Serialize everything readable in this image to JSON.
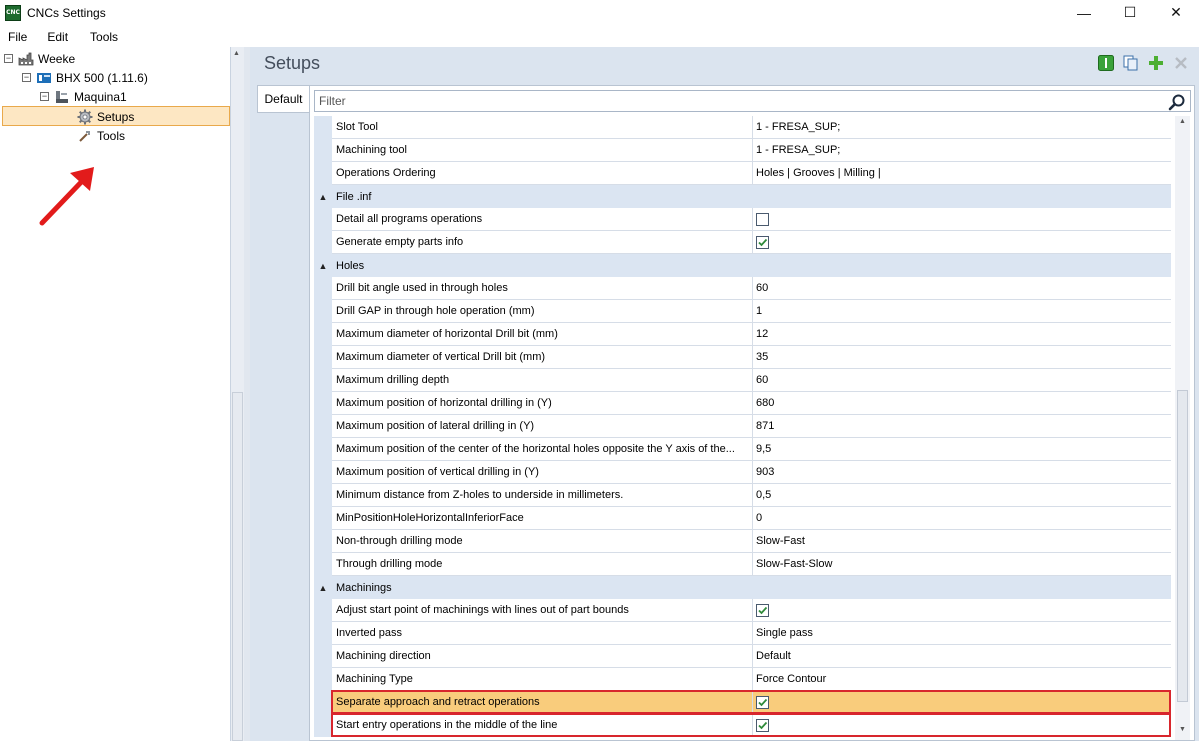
{
  "window": {
    "icon_text": "CNC",
    "title": "CNCs Settings",
    "controls": {
      "minimize": "—",
      "maximize": "☐",
      "close": "✕"
    }
  },
  "menu": [
    "File",
    "Edit",
    "Tools"
  ],
  "tree": {
    "items": [
      {
        "label": "Weeke",
        "toggle": "−",
        "icon": "factory-icon"
      },
      {
        "label": "BHX 500 (1.11.6)",
        "toggle": "−",
        "icon": "cnc-machine-icon"
      },
      {
        "label": "Maquina1",
        "toggle": "−",
        "icon": "machine-icon"
      },
      {
        "label": "Setups",
        "icon": "gear-icon",
        "selected": true
      },
      {
        "label": "Tools",
        "icon": "tools-icon"
      }
    ]
  },
  "panel": {
    "title": "Setups",
    "tab": "Default",
    "filter_placeholder": "Filter",
    "toolbar": [
      "info-icon",
      "copy-icon",
      "add-icon",
      "delete-icon"
    ]
  },
  "grid": {
    "rows": [
      {
        "kind": "prop",
        "name": "Slot Tool",
        "value": "1 - FRESA_SUP;"
      },
      {
        "kind": "prop",
        "name": "Machining tool",
        "value": "1 - FRESA_SUP;"
      },
      {
        "kind": "prop",
        "name": "Operations Ordering",
        "value": "Holes | Grooves | Milling |"
      },
      {
        "kind": "cat",
        "name": "File .inf"
      },
      {
        "kind": "prop",
        "name": "Detail all programs operations",
        "check": false
      },
      {
        "kind": "prop",
        "name": "Generate empty parts info",
        "check": true
      },
      {
        "kind": "cat",
        "name": "Holes"
      },
      {
        "kind": "prop",
        "name": "Drill bit angle used in through holes",
        "value": "60"
      },
      {
        "kind": "prop",
        "name": "Drill GAP in through hole operation (mm)",
        "value": "1"
      },
      {
        "kind": "prop",
        "name": "Maximum diameter of horizontal Drill bit (mm)",
        "value": "12"
      },
      {
        "kind": "prop",
        "name": "Maximum diameter of vertical Drill bit (mm)",
        "value": "35"
      },
      {
        "kind": "prop",
        "name": "Maximum drilling depth",
        "value": "60"
      },
      {
        "kind": "prop",
        "name": "Maximum position of horizontal drilling in (Y)",
        "value": "680"
      },
      {
        "kind": "prop",
        "name": "Maximum position of lateral drilling in (Y)",
        "value": "871"
      },
      {
        "kind": "prop",
        "name": "Maximum position of the center of the horizontal holes opposite the Y axis of the...",
        "value": "9,5"
      },
      {
        "kind": "prop",
        "name": "Maximum position of vertical drilling in (Y)",
        "value": "903"
      },
      {
        "kind": "prop",
        "name": "Minimum distance from Z-holes to underside in millimeters.",
        "value": "0,5"
      },
      {
        "kind": "prop",
        "name": "MinPositionHoleHorizontalInferiorFace",
        "value": "0"
      },
      {
        "kind": "prop",
        "name": "Non-through drilling mode",
        "value": "Slow-Fast"
      },
      {
        "kind": "prop",
        "name": "Through drilling mode",
        "value": "Slow-Fast-Slow"
      },
      {
        "kind": "cat",
        "name": "Machinings"
      },
      {
        "kind": "prop",
        "name": "Adjust start point of machinings with lines out of part bounds",
        "check": true
      },
      {
        "kind": "prop",
        "name": "Inverted pass",
        "value": "Single pass"
      },
      {
        "kind": "prop",
        "name": "Machining direction",
        "value": "Default"
      },
      {
        "kind": "prop",
        "name": "Machining Type",
        "value": "Force Contour"
      },
      {
        "kind": "prop",
        "name": "Separate approach and retract operations",
        "check": true,
        "highlight": true,
        "boxed": true
      },
      {
        "kind": "prop",
        "name": "Start entry operations in the middle of the line",
        "check": true,
        "boxed": true
      }
    ]
  },
  "colors": {
    "selection": "#f9cc7c",
    "annotation_red": "#d8262d",
    "category_bg": "#dbe5f2"
  }
}
